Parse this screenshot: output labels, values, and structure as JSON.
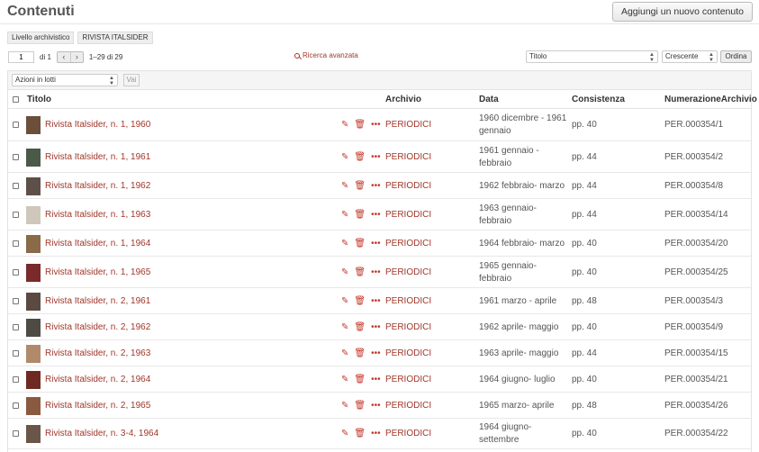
{
  "header": {
    "title": "Contenuti",
    "add_button": "Aggiungi un nuovo contenuto"
  },
  "breadcrumb": [
    "Livello archivistico",
    "RIVISTA ITALSIDER"
  ],
  "pagination": {
    "page_value": "1",
    "of_label": "di 1",
    "prev": "‹",
    "next": "›",
    "range_label": "1–29 di 29"
  },
  "advanced_search": "Ricerca avanzata",
  "sort": {
    "field": "Titolo",
    "direction": "Crescente",
    "order_button": "Ordina"
  },
  "bulk": {
    "select_value": "Azioni in lotti",
    "go_button": "Vai"
  },
  "columns": {
    "title": "Titolo",
    "archive": "Archivio",
    "date": "Data",
    "size": "Consistenza",
    "number": "NumerazioneArchivio"
  },
  "icons": {
    "edit": "pencil-icon",
    "delete": "trash-icon",
    "more": "more-icon"
  },
  "colors": {
    "link": "#a0372a",
    "icon": "#c0392b"
  },
  "rows": [
    {
      "title": "Rivista Italsider, n. 1, 1960",
      "archive": "PERIODICI",
      "date": "1960 dicembre - 1961 gennaio",
      "size": "pp. 40",
      "number": "PER.000354/1",
      "thumb": "#6b4f3a"
    },
    {
      "title": "Rivista Italsider, n. 1, 1961",
      "archive": "PERIODICI",
      "date": "1961 gennaio - febbraio",
      "size": "pp. 44",
      "number": "PER.000354/2",
      "thumb": "#4a5a48"
    },
    {
      "title": "Rivista Italsider, n. 1, 1962",
      "archive": "PERIODICI",
      "date": "1962 febbraio- marzo",
      "size": "pp. 44",
      "number": "PER.000354/8",
      "thumb": "#5e5048"
    },
    {
      "title": "Rivista Italsider, n. 1, 1963",
      "archive": "PERIODICI",
      "date": "1963 gennaio- febbraio",
      "size": "pp. 44",
      "number": "PER.000354/14",
      "thumb": "#cfc7bb"
    },
    {
      "title": "Rivista Italsider, n. 1, 1964",
      "archive": "PERIODICI",
      "date": "1964 febbraio- marzo",
      "size": "pp. 40",
      "number": "PER.000354/20",
      "thumb": "#8a6a48"
    },
    {
      "title": "Rivista Italsider, n. 1, 1965",
      "archive": "PERIODICI",
      "date": "1965 gennaio- febbraio",
      "size": "pp. 40",
      "number": "PER.000354/25",
      "thumb": "#7a2a2a"
    },
    {
      "title": "Rivista Italsider, n. 2, 1961",
      "archive": "PERIODICI",
      "date": "1961 marzo - aprile",
      "size": "pp. 48",
      "number": "PER.000354/3",
      "thumb": "#5a4a42"
    },
    {
      "title": "Rivista Italsider, n. 2, 1962",
      "archive": "PERIODICI",
      "date": "1962 aprile- maggio",
      "size": "pp. 40",
      "number": "PER.000354/9",
      "thumb": "#4e4a44"
    },
    {
      "title": "Rivista Italsider, n. 2, 1963",
      "archive": "PERIODICI",
      "date": "1963 aprile- maggio",
      "size": "pp. 44",
      "number": "PER.000354/15",
      "thumb": "#b08a6a"
    },
    {
      "title": "Rivista Italsider, n. 2, 1964",
      "archive": "PERIODICI",
      "date": "1964 giugno- luglio",
      "size": "pp. 40",
      "number": "PER.000354/21",
      "thumb": "#6e2a22"
    },
    {
      "title": "Rivista Italsider, n. 2, 1965",
      "archive": "PERIODICI",
      "date": "1965 marzo- aprile",
      "size": "pp. 48",
      "number": "PER.000354/26",
      "thumb": "#8a5a40"
    },
    {
      "title": "Rivista Italsider, n. 3-4, 1964",
      "archive": "PERIODICI",
      "date": "1964 giugno- settembre",
      "size": "pp. 40",
      "number": "PER.000354/22",
      "thumb": "#6a5648"
    }
  ]
}
